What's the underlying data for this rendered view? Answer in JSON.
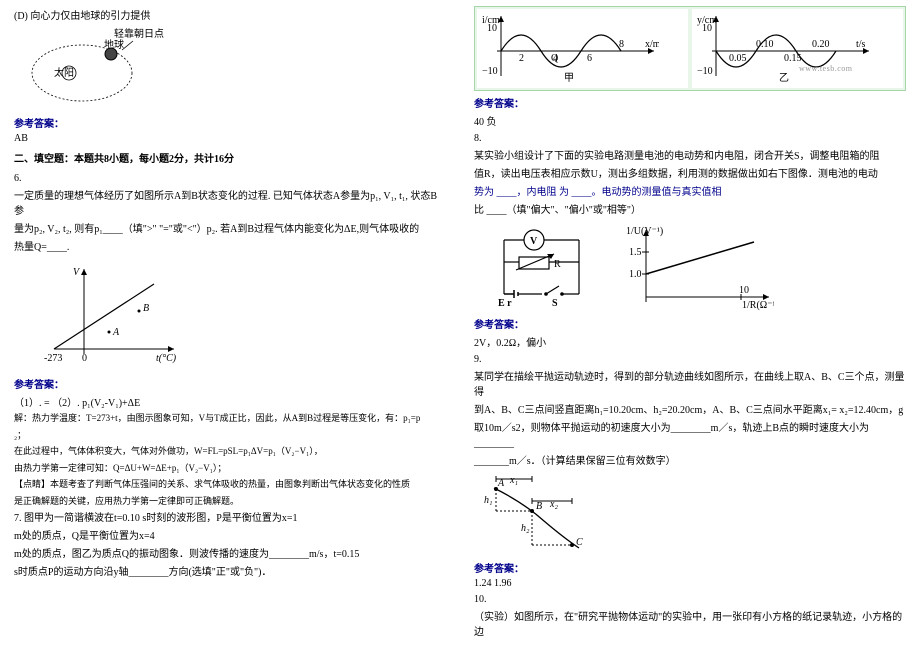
{
  "left": {
    "optD": "(D) 向心力仅由地球的引力提供",
    "orbit": {
      "sun": "太阳",
      "earth": "地球",
      "aphelion": "轻靠朝日点"
    },
    "ansLabel": "参考答案：",
    "ans5": "AB",
    "section2": "二、填空题：本题共8小题，每小题2分，共计16分",
    "q6_num": "6.",
    "q6_text1": "一定质量的理想气体经历了如图所示A到B状态变化的过程. 已知气体状态A参量为p₁, V₁, t₁, 状态B参",
    "q6_text2": "量为p₂, V₂, t₂, 则有p₁____（填\">\" \"=\"或\"<\"）p₂. 若A到B过程气体内能变化为ΔE,则气体吸收的",
    "q6_text3": "热量Q=____.",
    "graph6": {
      "y": "V",
      "x": "t(°C)",
      "tick": "-273",
      "zero": "0",
      "a": "A",
      "b": "B"
    },
    "ans6_1": "（1）. =    （2）. p₁(V₂-V₁)+ΔE",
    "exp6_1": "解：热力学温度：T=273+t，由图示图象可知，V与T成正比，因此，从A到B过程是等压变化，有：p₁=p",
    "exp6_2": "₂；",
    "exp6_3": "在此过程中，气体体积变大，气体对外做功，W=FL=pSL=p₁ΔV=p₁（V₂−V₁），",
    "exp6_4": "由热力学第一定律可知：Q=ΔU+W=ΔE+p₁（V₂−V₁）；",
    "exp6_5": "【点睛】本题考查了判断气体压强间的关系、求气体吸收的热量，由图象判断出气体状态变化的性质",
    "exp6_6": "是正确解题的关键，应用热力学第一定律即可正确解题。",
    "q7_1": "7. 图甲为一简谐横波在t=0.10 s时刻的波形图，P是平衡位置为x=1",
    "q7_2": "m处的质点，Q是平衡位置为x=4",
    "q7_3": "m处的质点，图乙为质点Q的振动图象．则波传播的速度为________m/s，t=0.15",
    "q7_4": "s时质点P的运动方向沿y轴________方向(选填\"正\"或\"负\")．"
  },
  "right": {
    "wave": {
      "y1": "i/cm",
      "y2": "y/cm",
      "ymax": "10",
      "yneg": "−10",
      "x1": "x/m",
      "wm": "www.tesb.com",
      "甲": "甲",
      "乙": "乙",
      "t1": "0.05",
      "t2": "0.10",
      "t3": "0.15",
      "t4": "0.20",
      "tlab": "t/s"
    },
    "ansLabel": "参考答案：",
    "ans7": "40   负",
    "q8_num": "8.",
    "q8_1": "某实验小组设计了下面的实验电路测量电池的电动势和内电阻，闭合开关S，调整电阻箱的阻",
    "q8_2": "值R，读出电压表相应示数U，测出多组数据，利用测的数据做出如右下图像．测电池的电动",
    "q8_3": "势为 ____，内电阻 为 ____。电动势的测量值与真实值相",
    "q8_4": "比 ____（填\"偏大\"、\"偏小\"或\"相等\"）",
    "circuit": {
      "E": "E r",
      "S": "S",
      "R": "R",
      "V": "V",
      "ya": "1/U(V⁻¹)",
      "xa": "1/R(Ω⁻¹)",
      "ytick1": "1.0",
      "ytick2": "1.5",
      "xtick": "10"
    },
    "ans8": "2V，0.2Ω，偏小",
    "q9_num": "9.",
    "q9_1": "某同学在描绘平抛运动轨迹时，得到的部分轨迹曲线如图所示，在曲线上取A、B、C三个点，测量得",
    "q9_2": "到A、B、C三点间竖直距离h₁=10.20cm、h₂=20.20cm，A、B、C三点间水平距离x₁= x₂=12.40cm，g",
    "q9_3": "取10m／s2，则物体平抛运动的初速度大小为________m／s，轨迹上B点的瞬时速度大小为________",
    "q9_4": "_______m／s．（计算结果保留三位有效数字）",
    "proj": {
      "A": "A",
      "B": "B",
      "C": "C",
      "h1": "h₁",
      "h2": "h₂",
      "x1": "x₁",
      "x2": "x₂"
    },
    "ans9": "1.24           1.96",
    "q10_num": "10.",
    "q10_1": "（实验）如图所示，在\"研究平抛物体运动\"的实验中，用一张印有小方格的纸记录轨迹，小方格的边"
  }
}
